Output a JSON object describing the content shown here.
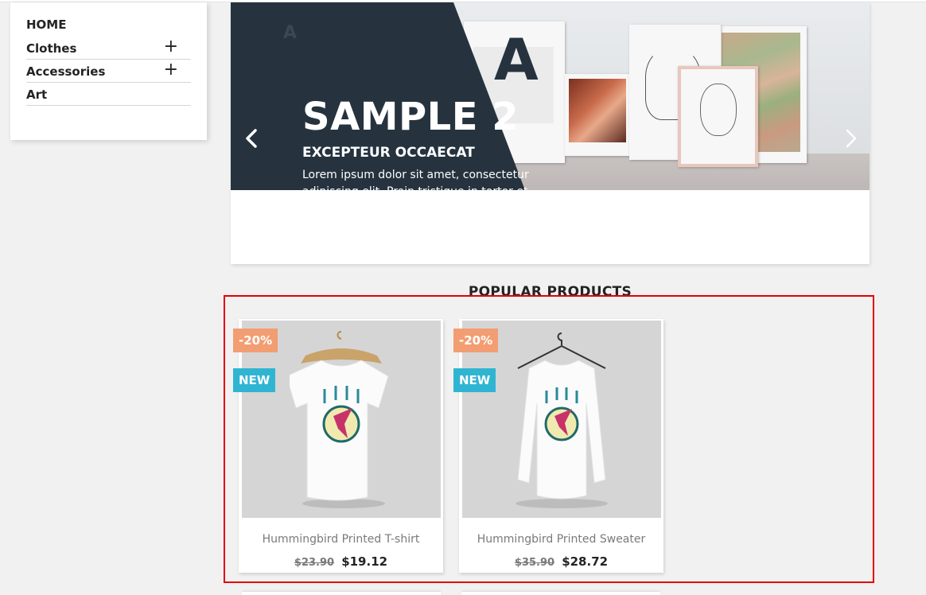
{
  "sidebar": {
    "home_label": "HOME",
    "items": [
      {
        "label": "Clothes",
        "expandable": true
      },
      {
        "label": "Accessories",
        "expandable": true
      },
      {
        "label": "Art",
        "expandable": false
      }
    ],
    "expand_glyph": "+"
  },
  "carousel": {
    "title": "SAMPLE 2",
    "subtitle": "EXCEPTEUR OCCAECAT",
    "description": "Lorem ipsum dolor sit amet, consectetur adipiscing elit. Proin tristique in tortor et dignissim. Quisque non tempor leo. Maecenas egestas sem elit",
    "prev_icon": "chevron-left-icon",
    "next_icon": "chevron-right-icon",
    "slide_bg": "#26333f"
  },
  "popular": {
    "title": "POPULAR PRODUCTS",
    "products": [
      {
        "name": "Hummingbird Printed T-shirt",
        "regular_price": "$23.90",
        "price": "$19.12",
        "discount_badge": "-20%",
        "new_badge": "NEW"
      },
      {
        "name": "Hummingbird Printed Sweater",
        "regular_price": "$35.90",
        "price": "$28.72",
        "discount_badge": "-20%",
        "new_badge": "NEW"
      }
    ]
  },
  "colors": {
    "discount_badge": "#f39d72",
    "new_badge": "#2fb5d2",
    "highlight_box": "#e30000"
  }
}
